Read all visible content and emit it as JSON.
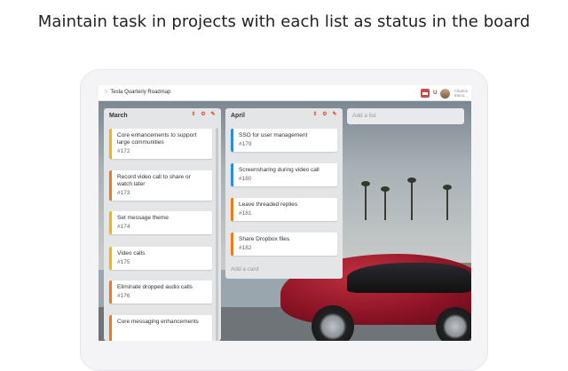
{
  "headline": "Maintain task in projects with each list as status in the board",
  "topbar": {
    "board_title": "Tesla Quarterly Roadmap",
    "user_initial": "U",
    "user_name_line1": "Charles",
    "user_name_line2": "Steno..."
  },
  "lists": [
    {
      "title": "March",
      "cards": [
        {
          "title": "Core enhancements to support large communities",
          "number": "#172",
          "color": "#f2b705"
        },
        {
          "title": "Record video call to share or watch later",
          "number": "#173",
          "color": "#f07a1a"
        },
        {
          "title": "Set message theme",
          "number": "#174",
          "color": "#f2b705"
        },
        {
          "title": "Video calls",
          "number": "#175",
          "color": "#f2b705"
        },
        {
          "title": "Eliminate dropped audio calls",
          "number": "#176",
          "color": "#f07a1a"
        },
        {
          "title": "Core messaging enhancements",
          "number": "",
          "color": "#f07a1a"
        }
      ]
    },
    {
      "title": "April",
      "cards": [
        {
          "title": "SSO for user management",
          "number": "#179",
          "color": "#2b8fd6"
        },
        {
          "title": "Screensharing during video call",
          "number": "#180",
          "color": "#2b8fd6"
        },
        {
          "title": "Leave threaded replies",
          "number": "#181",
          "color": "#f07a1a"
        },
        {
          "title": "Share Dropbox files",
          "number": "#182",
          "color": "#f07a1a"
        }
      ],
      "add_card": "Add a card"
    }
  ],
  "add_list": "Add a list",
  "icons": {
    "sort": "sort-icon",
    "settings": "gear-icon",
    "edit": "pencil-icon",
    "star": "star-icon"
  }
}
